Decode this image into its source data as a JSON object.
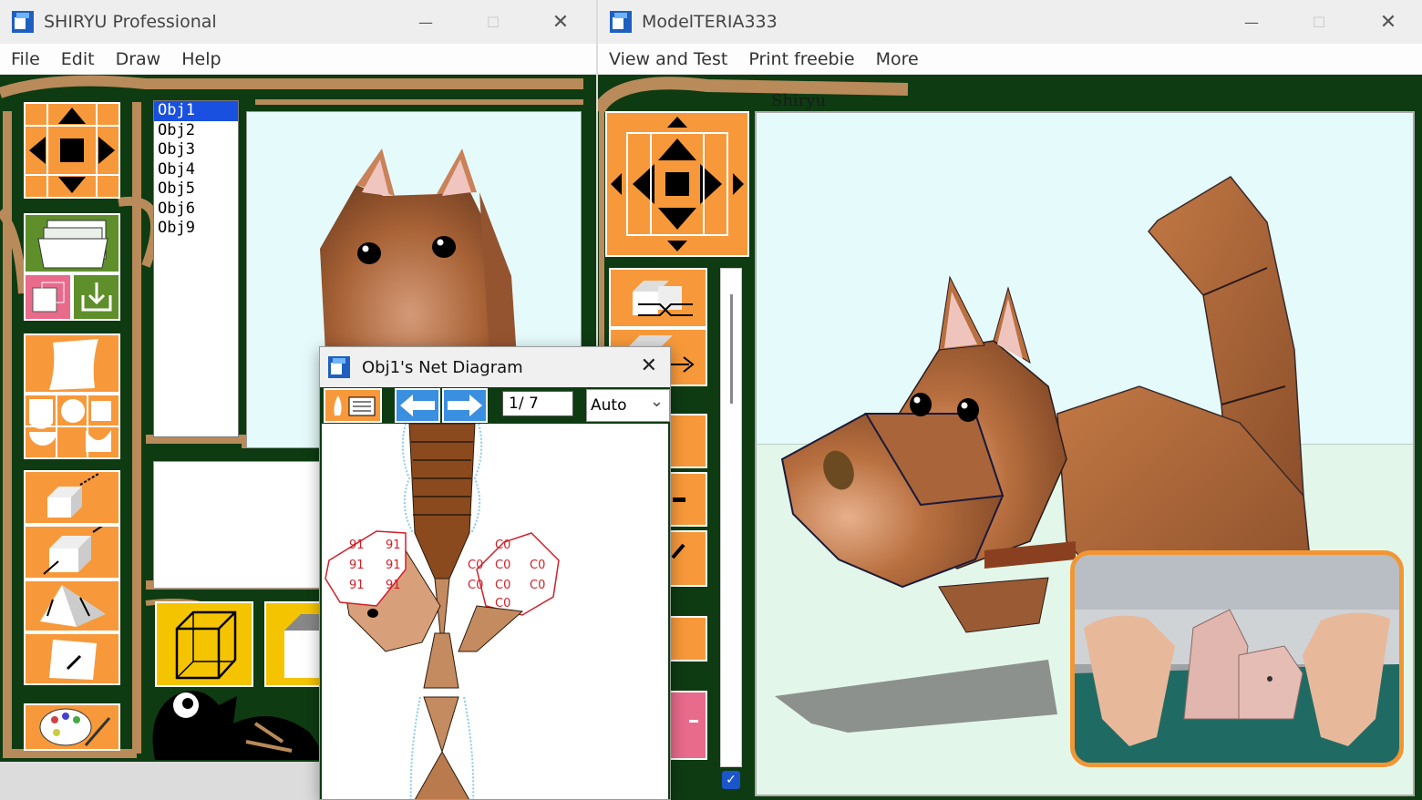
{
  "windows": {
    "shiryu": {
      "title": "SHIRYU Professional",
      "menu": [
        "File",
        "Edit",
        "Draw",
        "Help"
      ],
      "objects": [
        "Obj1",
        "Obj2",
        "Obj3",
        "Obj4",
        "Obj5",
        "Obj6",
        "Obj9"
      ],
      "selected_object": "Obj1"
    },
    "modeliteria": {
      "title": "ModelTERIA333",
      "menu": [
        "View and Test",
        "Print freebie",
        "More"
      ],
      "canvas_label": "Shiryu"
    },
    "net_diagram": {
      "title": "Obj1's Net Diagram",
      "page_indicator": "1/ 7",
      "scale_select": "Auto",
      "left_patch_labels": [
        "91",
        "91",
        "91",
        "91",
        "91",
        "91"
      ],
      "right_patch_labels": [
        "C0",
        "C0",
        "C0",
        "C0",
        "C0",
        "C0",
        "C0",
        "C0",
        "C0"
      ]
    }
  },
  "controls": {
    "minimize_glyph": "—",
    "maximize_glyph": "☐",
    "close_glyph": "✕",
    "dropdown_glyph": "⌄"
  },
  "colors": {
    "tool_orange": "#f7993a",
    "workspace_green": "#0e3b12",
    "frame_tan": "#b98a5a",
    "viewport_sky": "#e5fafb",
    "viewport_ground": "#e2f7ea",
    "selection_blue": "#1a50e0",
    "cat_brown": "#b46c3e",
    "pip_border": "#f29634"
  },
  "icons": [
    "app-icon",
    "arrow-cross-icon",
    "folder-open-icon",
    "save-icon",
    "sheet-icon",
    "shapes-icon",
    "box-icon",
    "palette-icon",
    "checkbox-icon"
  ]
}
